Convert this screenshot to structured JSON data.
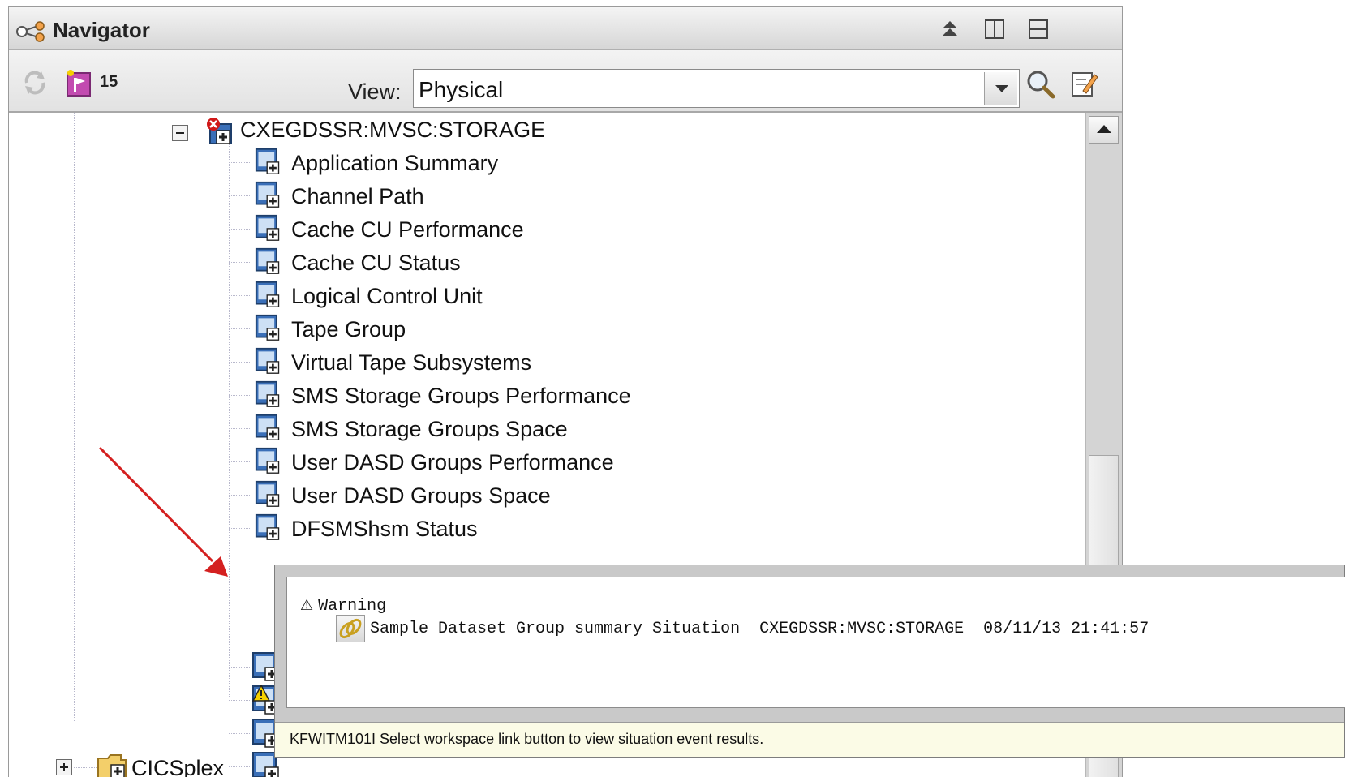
{
  "navigator": {
    "title": "Navigator",
    "situation_count": "15",
    "view_label": "View:",
    "view_value": "Physical"
  },
  "tree": {
    "parent": "CXEGDSSR:MVSC:STORAGE",
    "items": [
      {
        "label": "Application Summary"
      },
      {
        "label": "Channel Path"
      },
      {
        "label": "Cache CU Performance"
      },
      {
        "label": "Cache CU Status"
      },
      {
        "label": "Logical Control Unit"
      },
      {
        "label": "Tape Group"
      },
      {
        "label": "Virtual Tape Subsystems"
      },
      {
        "label": "SMS Storage Groups Performance"
      },
      {
        "label": "SMS Storage Groups Space"
      },
      {
        "label": "User DASD Groups Performance"
      },
      {
        "label": "User DASD Groups Space"
      },
      {
        "label": "DFSMShsm Status"
      }
    ],
    "sibling": "CICSplex"
  },
  "popup": {
    "severity": "Warning",
    "event": {
      "name": "Sample Dataset Group summary Situation",
      "source": "CXEGDSSR:MVSC:STORAGE",
      "timestamp": "08/11/13 21:41:57"
    },
    "status_message": "KFWITM101I Select workspace link button to view situation event results."
  },
  "colors": {
    "warning_yellow": "#f5d000",
    "arrow_red": "#d42020",
    "error_red": "#d01818",
    "node_blue": "#3a6fb8"
  }
}
